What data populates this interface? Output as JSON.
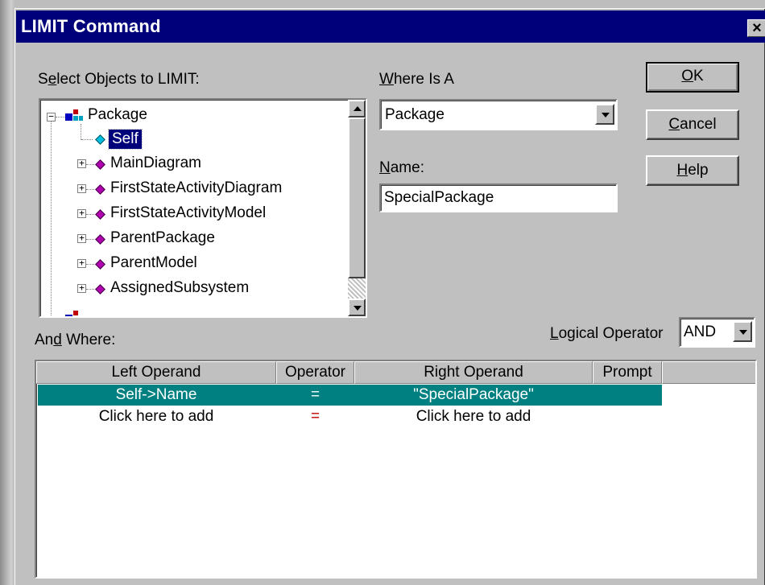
{
  "window": {
    "title": "LIMIT Command",
    "close_glyph": "×"
  },
  "select_objects": {
    "label_pre": "S",
    "label_ul": "e",
    "label_post": "lect Objects to LIMIT:",
    "tree": {
      "root": "Package",
      "items": [
        {
          "label": "Self",
          "icon": "diamond-cyan",
          "selected": true,
          "expandable": false
        },
        {
          "label": "MainDiagram",
          "icon": "diamond-magenta",
          "selected": false,
          "expandable": true
        },
        {
          "label": "FirstStateActivityDiagram",
          "icon": "diamond-magenta",
          "selected": false,
          "expandable": true
        },
        {
          "label": "FirstStateActivityModel",
          "icon": "diamond-magenta",
          "selected": false,
          "expandable": true
        },
        {
          "label": "ParentPackage",
          "icon": "diamond-magenta",
          "selected": false,
          "expandable": true
        },
        {
          "label": "ParentModel",
          "icon": "diamond-magenta",
          "selected": false,
          "expandable": true
        },
        {
          "label": "AssignedSubsystem",
          "icon": "diamond-magenta",
          "selected": false,
          "expandable": true
        }
      ]
    }
  },
  "where_is_a": {
    "label_pre": "",
    "label_ul": "W",
    "label_post": "here Is A",
    "value": "Package"
  },
  "name": {
    "label_pre": "",
    "label_ul": "N",
    "label_post": "ame:",
    "value": "SpecialPackage"
  },
  "buttons": {
    "ok": {
      "pre": "",
      "ul": "O",
      "post": "K"
    },
    "cancel": {
      "pre": "",
      "ul": "C",
      "post": "ancel"
    },
    "help": {
      "pre": "",
      "ul": "H",
      "post": "elp"
    }
  },
  "and_where": {
    "label_pre": "An",
    "label_ul": "d",
    "label_post": " Where:"
  },
  "logical_operator": {
    "label_pre": "",
    "label_ul": "L",
    "label_post": "ogical Operator",
    "value": "AND"
  },
  "table": {
    "columns": [
      "Left Operand",
      "Operator",
      "Right Operand",
      "Prompt"
    ],
    "rows": [
      {
        "left": "Self->Name",
        "op": "=",
        "right": "\"SpecialPackage\"",
        "prompt": "",
        "selected": true
      },
      {
        "left": "Click here to add",
        "op": "=",
        "right": "Click here to add",
        "prompt": "",
        "selected": false
      }
    ]
  },
  "colors": {
    "titlebar": "#00007b",
    "selection": "#00007b",
    "row_selection": "#008080",
    "operator_red": "#c00000"
  }
}
